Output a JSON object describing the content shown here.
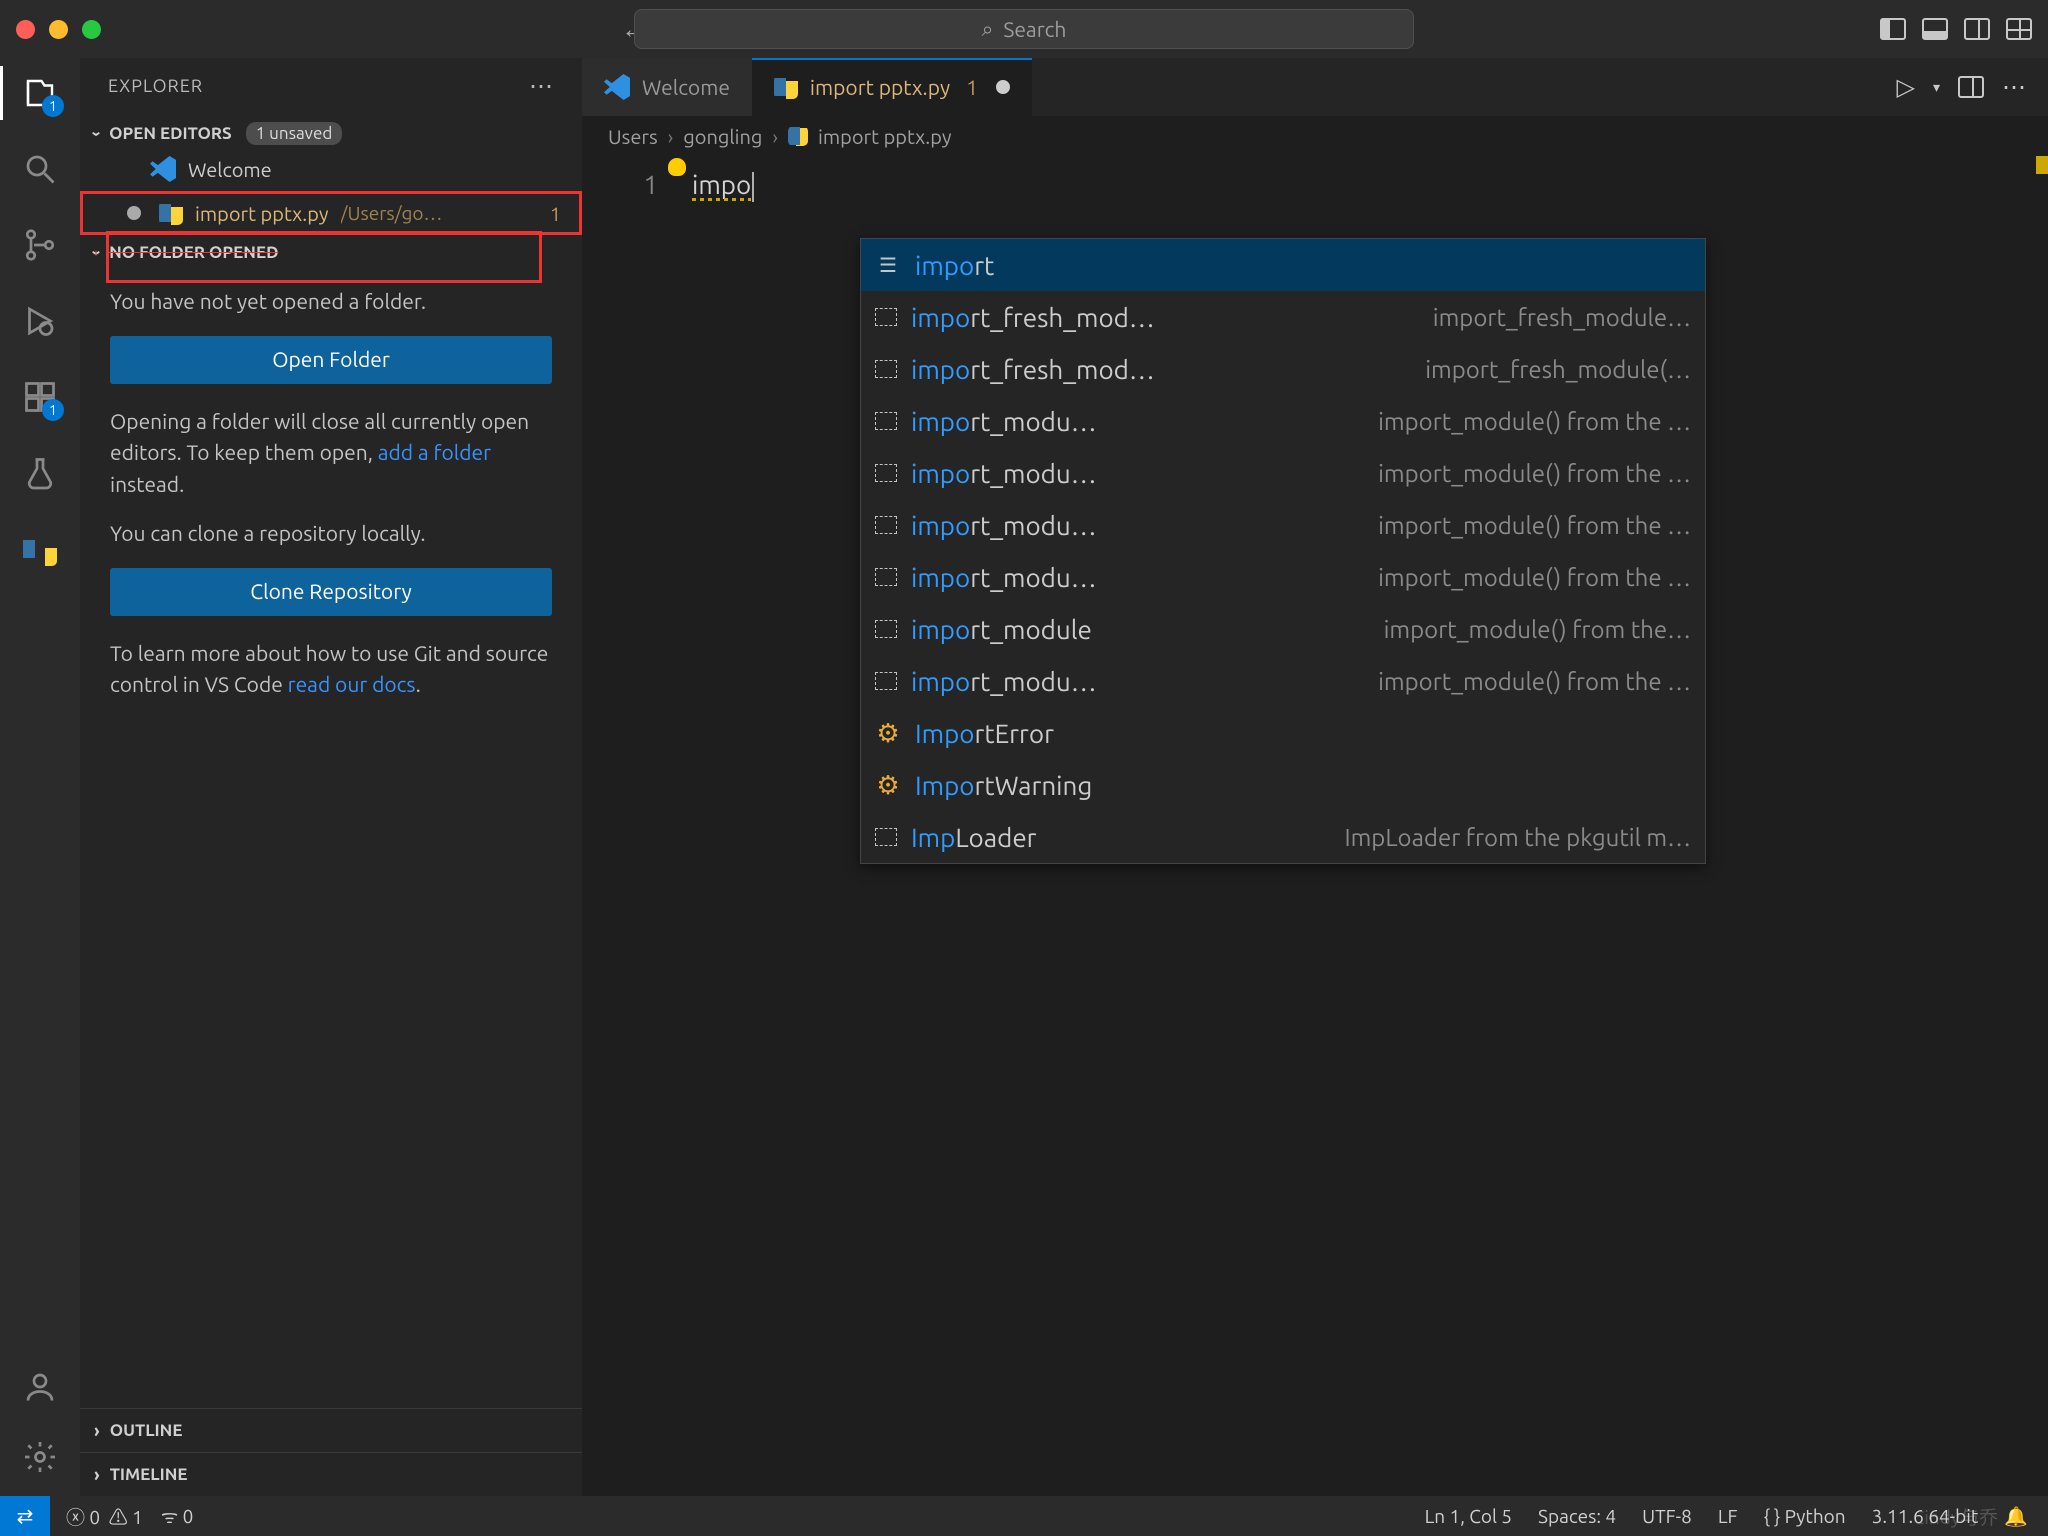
{
  "titlebar": {
    "search_placeholder": "Search"
  },
  "activitybar": {
    "explorer_badge": "1",
    "extensions_badge": "1"
  },
  "sidebar": {
    "title": "EXPLORER",
    "open_editors_label": "OPEN EDITORS",
    "unsaved_pill": "1 unsaved",
    "welcome_item": "Welcome",
    "edited_file": {
      "name": "import pptx.py",
      "path": "/Users/go…",
      "count": "1"
    },
    "no_folder_label": "NO FOLDER OPENED",
    "msg1": "You have not yet opened a folder.",
    "open_folder_btn": "Open Folder",
    "msg2a": "Opening a folder will close all currently open editors. To keep them open, ",
    "add_folder_link": "add a folder",
    "msg2b": " instead.",
    "msg3": "You can clone a repository locally.",
    "clone_btn": "Clone Repository",
    "msg4a": "To learn more about how to use Git and source control in VS Code ",
    "read_docs_link": "read our docs",
    "msg4b": ".",
    "outline": "OUTLINE",
    "timeline": "TIMELINE"
  },
  "tabs": {
    "welcome": "Welcome",
    "file": {
      "name": "import pptx.py",
      "count": "1"
    }
  },
  "breadcrumb": {
    "seg1": "Users",
    "seg2": "gongling",
    "seg3": "import pptx.py"
  },
  "editor": {
    "line_no": "1",
    "code_text": "impo"
  },
  "autocomplete": {
    "items": [
      {
        "kind": "kw",
        "match": "impo",
        "rest": "rt",
        "hint": ""
      },
      {
        "kind": "sn",
        "match": "impo",
        "rest": "rt_fresh_mod…",
        "hint": "import_fresh_module…"
      },
      {
        "kind": "sn",
        "match": "impo",
        "rest": "rt_fresh_mod…",
        "hint": "import_fresh_module(…"
      },
      {
        "kind": "sn",
        "match": "impo",
        "rest": "rt_modu…",
        "hint": "import_module() from the …"
      },
      {
        "kind": "sn",
        "match": "impo",
        "rest": "rt_modu…",
        "hint": "import_module() from the …"
      },
      {
        "kind": "sn",
        "match": "impo",
        "rest": "rt_modu…",
        "hint": "import_module() from the …"
      },
      {
        "kind": "sn",
        "match": "impo",
        "rest": "rt_modu…",
        "hint": "import_module() from the …"
      },
      {
        "kind": "sn",
        "match": "impo",
        "rest": "rt_module",
        "hint": "import_module() from the…"
      },
      {
        "kind": "sn",
        "match": "impo",
        "rest": "rt_modu…",
        "hint": "import_module() from the …"
      },
      {
        "kind": "cls",
        "match": "Impo",
        "rest": "rtError",
        "hint": ""
      },
      {
        "kind": "cls",
        "match": "Impo",
        "rest": "rtWarning",
        "hint": ""
      },
      {
        "kind": "sn",
        "match": "Imp",
        "rest": "Loader",
        "hint": "ImpLoader from the pkgutil m…"
      }
    ]
  },
  "statusbar": {
    "errors": "0",
    "warnings": "1",
    "ports": "0",
    "ln_col": "Ln 1, Col 5",
    "spaces": "Spaces: 4",
    "encoding": "UTF-8",
    "eol": "LF",
    "lang": "Python",
    "py_version": "3.11.6 64-bit",
    "watermark_user": "Cindy与乔"
  }
}
